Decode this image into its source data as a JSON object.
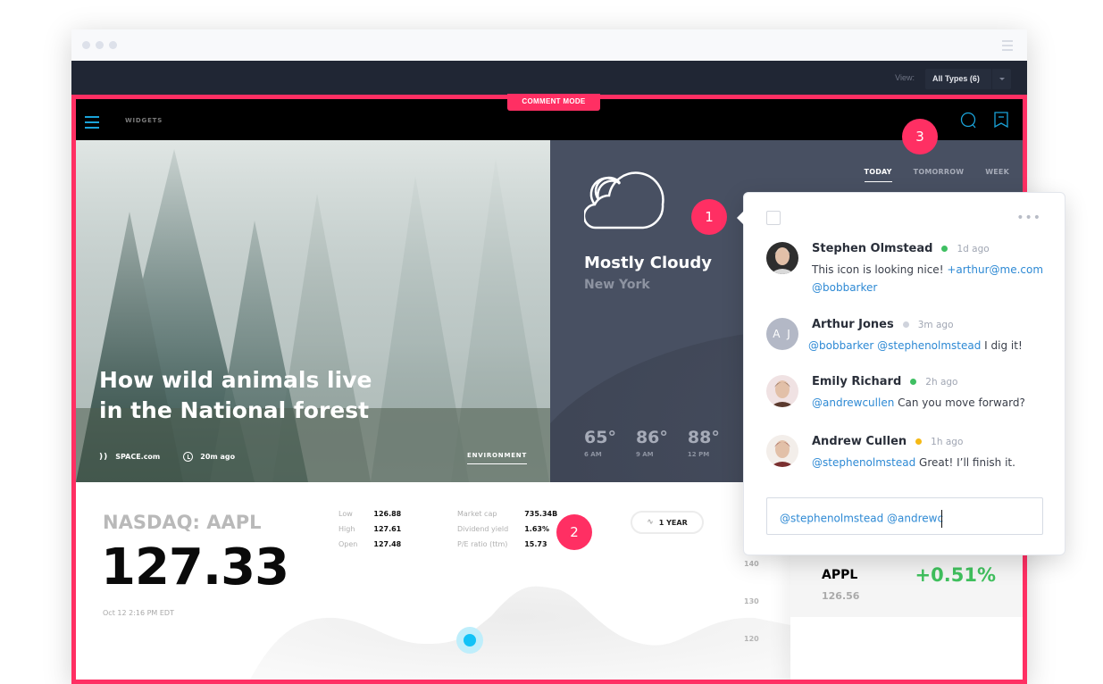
{
  "window": {
    "toolbar": {
      "view_label": "View:",
      "view_value": "All Types (6)"
    }
  },
  "comment_mode": "COMMENT MODE",
  "appbar": {
    "title": "WIDGETS"
  },
  "hero": {
    "title": "How wild animals live in the National forest",
    "source": "SPACE.com",
    "time": "20m ago",
    "tag": "ENVIRONMENT"
  },
  "weather": {
    "tabs": [
      {
        "label": "TODAY",
        "active": true
      },
      {
        "label": "TOMORROW",
        "active": false
      },
      {
        "label": "WEEK",
        "active": false
      }
    ],
    "condition": "Mostly Cloudy",
    "location": "New York",
    "hourly": [
      {
        "temp": "65°",
        "time": "6 AM"
      },
      {
        "temp": "86°",
        "time": "9 AM"
      },
      {
        "temp": "88°",
        "time": "12 PM"
      }
    ]
  },
  "stock": {
    "ticker": "NASDAQ: AAPL",
    "price": "127.33",
    "as_of": "Oct 12 2:16 PM EDT",
    "stats_left": [
      {
        "k": "Low",
        "v": "126.88"
      },
      {
        "k": "High",
        "v": "127.61"
      },
      {
        "k": "Open",
        "v": "127.48"
      }
    ],
    "stats_right": [
      {
        "k": "Market cap",
        "v": "735.34B"
      },
      {
        "k": "Dividend yield",
        "v": "1.63%"
      },
      {
        "k": "P/E ratio (ttm)",
        "v": "15.73"
      }
    ],
    "range_label": "1 YEAR",
    "y_ticks": [
      "140",
      "130",
      "120"
    ]
  },
  "quote": {
    "symbol": "APPL",
    "price": "126.56",
    "change": "+0.51%"
  },
  "pins": [
    "1",
    "2",
    "3"
  ],
  "comments_panel": {
    "comments": [
      {
        "name": "Stephen Olmstead",
        "status": "online",
        "status_color": "#3fbf62",
        "time": "1d ago",
        "avatar": "photo",
        "body": [
          {
            "t": "This icon is looking nice! ",
            "m": false
          },
          {
            "t": "+arthur@me.com",
            "m": true
          },
          {
            "t": " ",
            "m": false
          },
          {
            "t": "@bobbarker",
            "m": true
          }
        ]
      },
      {
        "name": "Arthur Jones",
        "status": "offline",
        "status_color": "#cfd3dc",
        "time": "3m ago",
        "avatar": "AJ",
        "body": [
          {
            "t": "@bobbarker @stephenolmstead",
            "m": true
          },
          {
            "t": " I dig it!",
            "m": false
          }
        ]
      },
      {
        "name": "Emily Richard",
        "status": "online",
        "status_color": "#3fbf62",
        "time": "2h ago",
        "avatar": "photo",
        "body": [
          {
            "t": "@andrewcullen",
            "m": true
          },
          {
            "t": " Can you move forward?",
            "m": false
          }
        ]
      },
      {
        "name": "Andrew Cullen",
        "status": "away",
        "status_color": "#f5b915",
        "time": "1h ago",
        "avatar": "photo",
        "body": [
          {
            "t": "@stephenolmstead",
            "m": true
          },
          {
            "t": " Great! I’ll finish it.",
            "m": false
          }
        ]
      }
    ],
    "reply_value": "@stephenolmstead @andrewc"
  }
}
